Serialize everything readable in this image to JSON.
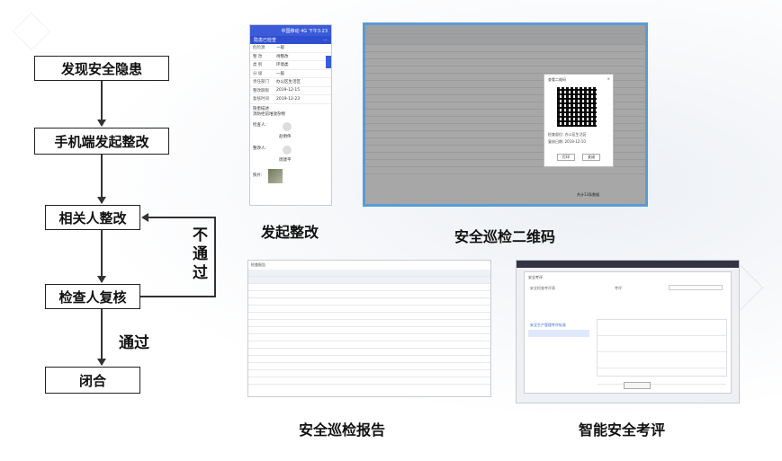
{
  "flow": {
    "step1": "发现安全隐患",
    "step2": "手机端发起整改",
    "step3": "相关人整改",
    "step4": "检查人复核",
    "step5": "闭合",
    "fail_label": "不\n通\n过",
    "pass_label": "通过"
  },
  "captions": {
    "phone": "发起整改",
    "qrcode": "安全巡检二维码",
    "report": "安全巡检报告",
    "assessment": "智能安全考评"
  },
  "phone": {
    "status": "中国移动 4G 下午3:23",
    "nav_title": "隐患已检查",
    "rows": [
      {
        "k": "危险源",
        "v": "一般"
      },
      {
        "k": "整 改",
        "v": "待整改"
      },
      {
        "k": "类 别",
        "v": "环境类"
      },
      {
        "k": "分 级",
        "v": "一般"
      },
      {
        "k": "责任部门",
        "v": "办公区生活区"
      },
      {
        "k": "整改期限",
        "v": "2019-12-15"
      },
      {
        "k": "复核时间",
        "v": "2019-12-23"
      }
    ],
    "desc_label": "隐患描述",
    "desc": "消防栓前堆放杂物",
    "inspector_label": "检查人:",
    "inspector": "赵明伟",
    "rectifier_label": "整改人:",
    "rectifier": "周建平",
    "photo_label": "照片:"
  },
  "qr_window": {
    "modal_title": "查看二维码",
    "line1": "检查部位: 办公区生活区",
    "line2": "复核日期: 2019-12-10",
    "btn_print": "打印",
    "btn_close": "关闭",
    "footer": "共计13条数据"
  },
  "report_window": {
    "title": "检查报告"
  },
  "assessment_window": {
    "title": "安全考评",
    "field1": "安全检查考评表",
    "field2": "考评",
    "section": "安全生产管理考评标准"
  }
}
